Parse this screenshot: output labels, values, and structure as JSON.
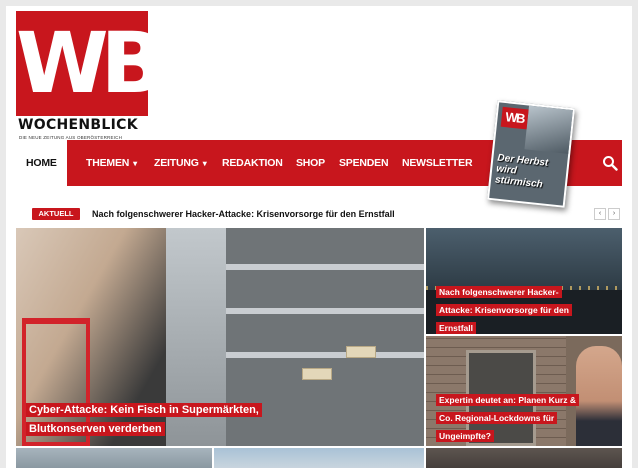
{
  "brand": {
    "logo_letters": "WB",
    "name": "WOCHENBLICK",
    "tagline": "DIE NEUE ZEITUNG AUS OBERÖSTERREICH",
    "accent_color": "#c8161d"
  },
  "nav": {
    "items": [
      {
        "label": "HOME",
        "active": true
      },
      {
        "label": "THEMEN",
        "dropdown": true
      },
      {
        "label": "ZEITUNG",
        "dropdown": true
      },
      {
        "label": "REDAKTION"
      },
      {
        "label": "SHOP"
      },
      {
        "label": "SPENDEN"
      },
      {
        "label": "NEWSLETTER"
      }
    ],
    "search_icon": "search-icon"
  },
  "cover": {
    "logo": "WB",
    "headline": "Der Herbst wird stürmisch"
  },
  "ticker": {
    "badge": "AKTUELL",
    "text": "Nach folgenschwerer Hacker-Attacke: Krisenvorsorge für den Ernstfall",
    "prev": "‹",
    "next": "›"
  },
  "articles": {
    "main": {
      "headline": "Cyber-Attacke: Kein Fisch in Supermärkten, Blutkonserven verderben"
    },
    "right_top": {
      "headline": "Nach folgenschwerer Hacker-Attacke: Krisenvorsorge für den Ernstfall"
    },
    "right_bottom": {
      "headline": "Expertin deutet an: Planen Kurz & Co. Regional-Lockdowns für Ungeimpfte?"
    }
  }
}
